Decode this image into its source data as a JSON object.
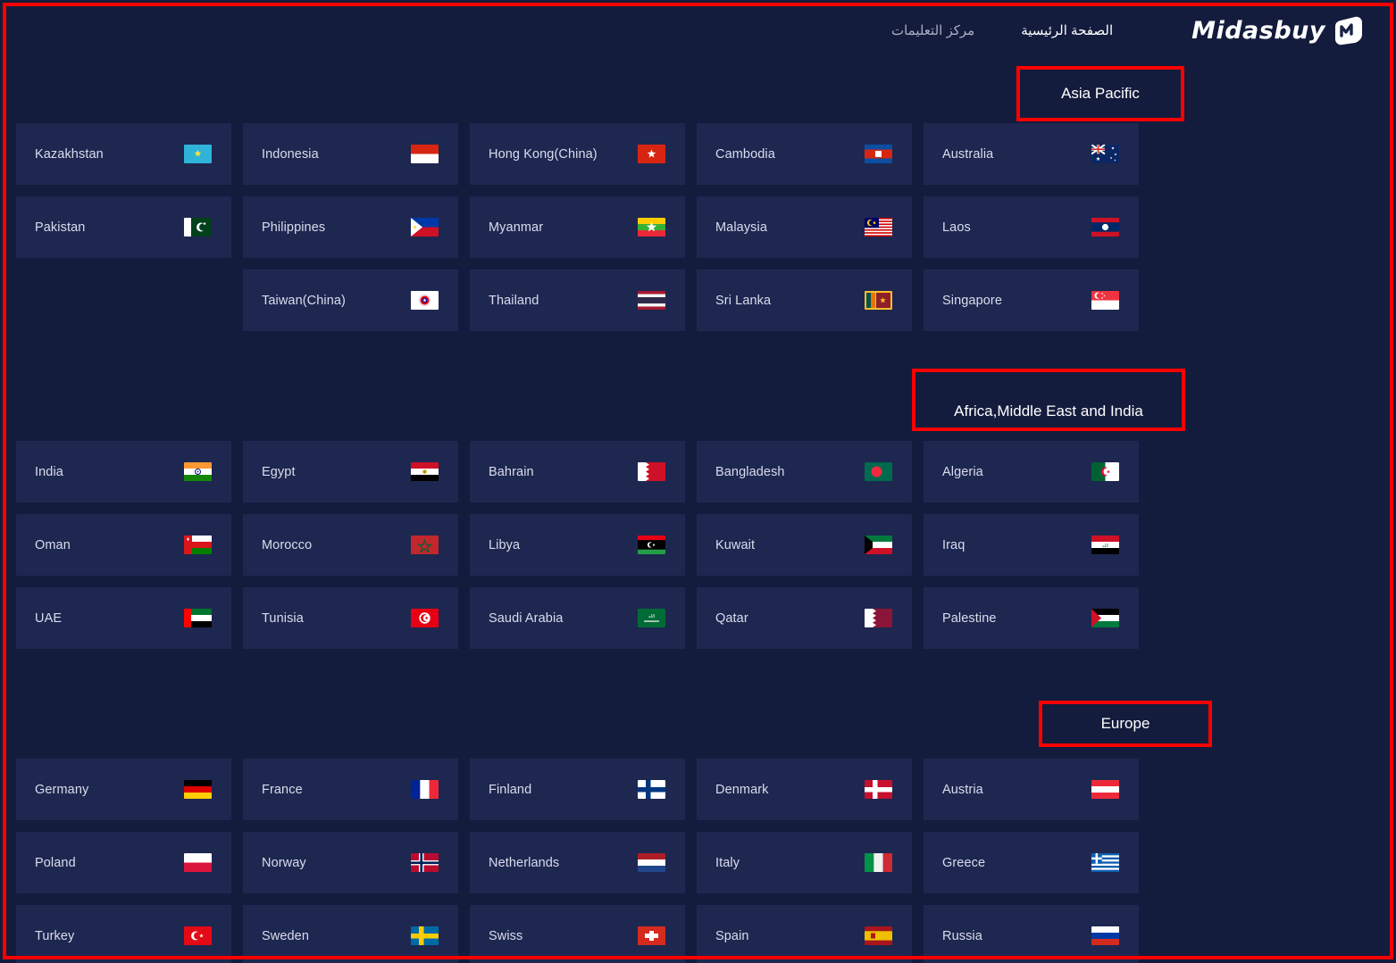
{
  "header": {
    "logo_text": "Midasbuy",
    "logo_icon": "midasbuy-logo-mark",
    "nav": [
      {
        "label": "الصفحة الرئيسية",
        "active": true
      },
      {
        "label": "مركز التعليمات",
        "active": false
      }
    ]
  },
  "regions": [
    {
      "title": "Asia Pacific",
      "countries": [
        {
          "name": "Kazakhstan",
          "flag": "kz"
        },
        {
          "name": "Indonesia",
          "flag": "id"
        },
        {
          "name": "Hong Kong(China)",
          "flag": "hk"
        },
        {
          "name": "Cambodia",
          "flag": "kh"
        },
        {
          "name": "Australia",
          "flag": "au"
        },
        {
          "name": "Pakistan",
          "flag": "pk"
        },
        {
          "name": "Philippines",
          "flag": "ph"
        },
        {
          "name": "Myanmar",
          "flag": "mm"
        },
        {
          "name": "Malaysia",
          "flag": "my"
        },
        {
          "name": "Laos",
          "flag": "la"
        },
        {
          "name": "",
          "flag": ""
        },
        {
          "name": "Taiwan(China)",
          "flag": "tw"
        },
        {
          "name": "Thailand",
          "flag": "th"
        },
        {
          "name": "Sri Lanka",
          "flag": "lk"
        },
        {
          "name": "Singapore",
          "flag": "sg"
        }
      ]
    },
    {
      "title": "Africa,Middle East and India",
      "countries": [
        {
          "name": "India",
          "flag": "in"
        },
        {
          "name": "Egypt",
          "flag": "eg"
        },
        {
          "name": "Bahrain",
          "flag": "bh"
        },
        {
          "name": "Bangladesh",
          "flag": "bd"
        },
        {
          "name": "Algeria",
          "flag": "dz"
        },
        {
          "name": "Oman",
          "flag": "om"
        },
        {
          "name": "Morocco",
          "flag": "ma"
        },
        {
          "name": "Libya",
          "flag": "ly"
        },
        {
          "name": "Kuwait",
          "flag": "kw"
        },
        {
          "name": "Iraq",
          "flag": "iq"
        },
        {
          "name": "UAE",
          "flag": "ae"
        },
        {
          "name": "Tunisia",
          "flag": "tn"
        },
        {
          "name": "Saudi Arabia",
          "flag": "sa"
        },
        {
          "name": "Qatar",
          "flag": "qa"
        },
        {
          "name": "Palestine",
          "flag": "ps"
        }
      ]
    },
    {
      "title": "Europe",
      "countries": [
        {
          "name": "Germany",
          "flag": "de"
        },
        {
          "name": "France",
          "flag": "fr"
        },
        {
          "name": "Finland",
          "flag": "fi"
        },
        {
          "name": "Denmark",
          "flag": "dk"
        },
        {
          "name": "Austria",
          "flag": "at"
        },
        {
          "name": "Poland",
          "flag": "pl"
        },
        {
          "name": "Norway",
          "flag": "no"
        },
        {
          "name": "Netherlands",
          "flag": "nl"
        },
        {
          "name": "Italy",
          "flag": "it"
        },
        {
          "name": "Greece",
          "flag": "gr"
        },
        {
          "name": "Turkey",
          "flag": "tr"
        },
        {
          "name": "Sweden",
          "flag": "se"
        },
        {
          "name": "Swiss",
          "flag": "ch"
        },
        {
          "name": "Spain",
          "flag": "es"
        },
        {
          "name": "Russia",
          "flag": "ru"
        }
      ]
    }
  ],
  "colors": {
    "background": "#141c3d",
    "card": "#1e2750",
    "text": "#d9dded",
    "annotation": "#ff0000",
    "accent": "#ffffff"
  }
}
